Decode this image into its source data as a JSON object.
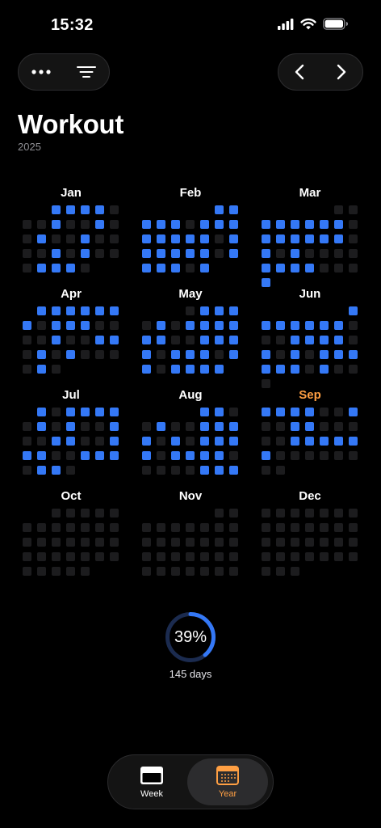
{
  "status_bar": {
    "time": "15:32"
  },
  "header": {
    "title": "Workout",
    "year": "2025",
    "more_icon": "ellipsis-icon",
    "filter_icon": "filter-lines-icon",
    "prev_icon": "chevron-left-icon",
    "next_icon": "chevron-right-icon"
  },
  "colors": {
    "done": "#3478f6",
    "empty": "#1c1c1e",
    "accent": "#ff9f43",
    "ring_track": "#1b2b4f"
  },
  "months": [
    {
      "label": "Jan",
      "current": false,
      "offset": 2,
      "days": 31,
      "done": [
        1,
        2,
        3,
        4,
        8,
        11,
        14,
        17,
        22,
        24,
        28,
        29,
        30
      ]
    },
    {
      "label": "Feb",
      "current": false,
      "offset": 5,
      "days": 28,
      "done": [
        1,
        2,
        3,
        4,
        5,
        7,
        8,
        9,
        10,
        11,
        12,
        13,
        14,
        16,
        17,
        18,
        19,
        20,
        21,
        23,
        24,
        25,
        26,
        28
      ]
    },
    {
      "label": "Mar",
      "current": false,
      "offset": 5,
      "days": 31,
      "done": [
        3,
        4,
        5,
        6,
        7,
        8,
        10,
        11,
        12,
        13,
        14,
        15,
        17,
        19,
        24,
        25,
        26,
        27,
        31
      ]
    },
    {
      "label": "Apr",
      "current": false,
      "offset": 1,
      "days": 30,
      "done": [
        1,
        2,
        3,
        4,
        5,
        6,
        7,
        9,
        10,
        11,
        16,
        19,
        20,
        22,
        24,
        29
      ]
    },
    {
      "label": "May",
      "current": false,
      "offset": 3,
      "days": 31,
      "done": [
        2,
        3,
        4,
        6,
        8,
        9,
        10,
        11,
        12,
        13,
        16,
        17,
        18,
        19,
        21,
        22,
        23,
        25,
        26,
        28,
        29,
        30,
        31
      ]
    },
    {
      "label": "Jun",
      "current": false,
      "offset": 6,
      "days": 30,
      "done": [
        1,
        2,
        3,
        4,
        5,
        6,
        7,
        11,
        12,
        13,
        14,
        16,
        18,
        20,
        21,
        22,
        23,
        24,
        25,
        27
      ]
    },
    {
      "label": "Jul",
      "current": false,
      "offset": 1,
      "days": 31,
      "done": [
        1,
        3,
        4,
        5,
        6,
        8,
        10,
        13,
        16,
        17,
        20,
        21,
        22,
        25,
        26,
        27,
        29,
        30
      ]
    },
    {
      "label": "Aug",
      "current": false,
      "offset": 4,
      "days": 31,
      "done": [
        1,
        2,
        5,
        8,
        9,
        10,
        11,
        13,
        15,
        16,
        17,
        18,
        20,
        21,
        22,
        23,
        29,
        30,
        31
      ]
    },
    {
      "label": "Sep",
      "current": true,
      "offset": 0,
      "days": 30,
      "done": [
        1,
        2,
        3,
        4,
        7,
        10,
        11,
        17,
        18,
        19,
        20,
        21,
        22
      ]
    },
    {
      "label": "Oct",
      "current": false,
      "offset": 2,
      "days": 31,
      "done": []
    },
    {
      "label": "Nov",
      "current": false,
      "offset": 5,
      "days": 30,
      "done": []
    },
    {
      "label": "Dec",
      "current": false,
      "offset": 0,
      "days": 31,
      "done": []
    }
  ],
  "summary": {
    "percent": 0.39,
    "percent_label": "39%",
    "days_label": "145 days"
  },
  "tabs": [
    {
      "label": "Week",
      "icon": "calendar-week-icon",
      "active": false
    },
    {
      "label": "Year",
      "icon": "calendar-grid-icon",
      "active": true
    }
  ]
}
